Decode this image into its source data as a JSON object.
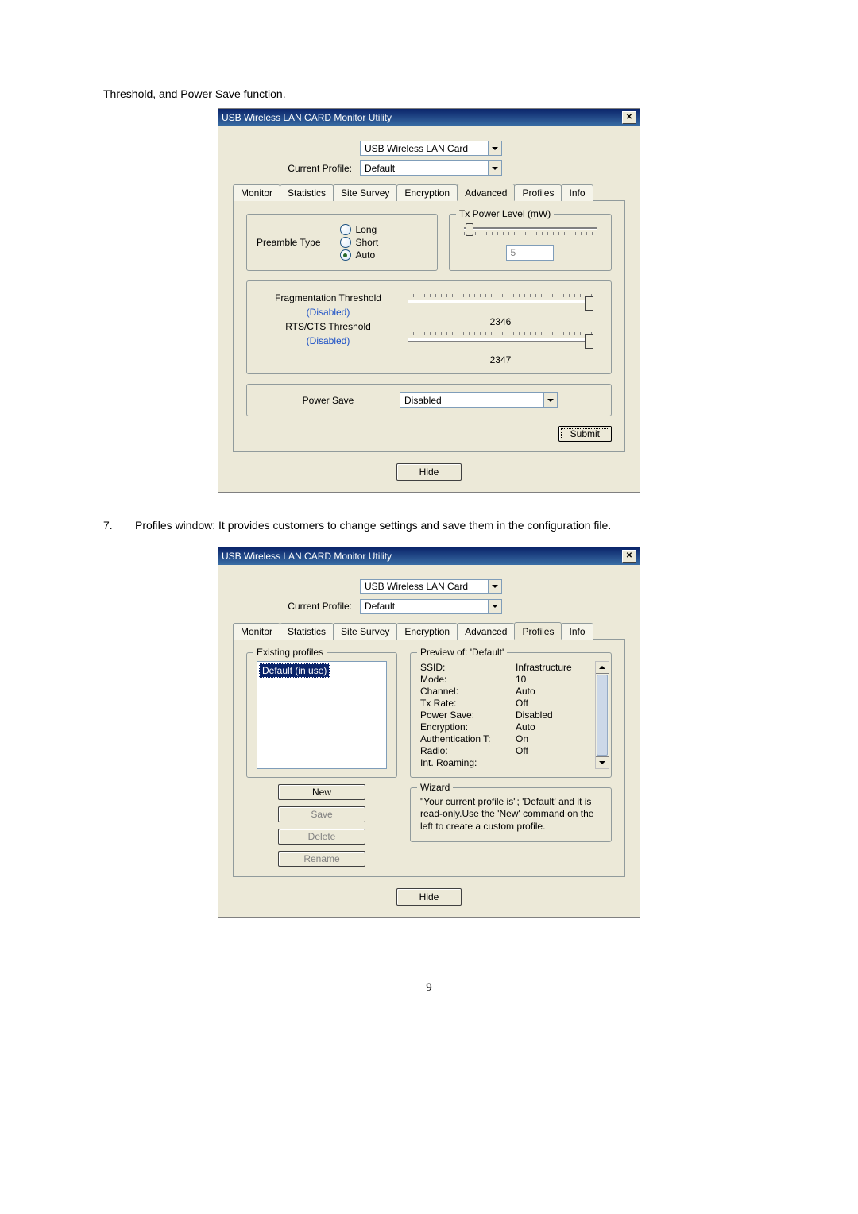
{
  "intro_line": "Threshold, and Power Save function.",
  "dialog1": {
    "title": "USB Wireless LAN CARD Monitor Utility",
    "card_dropdown": "USB Wireless LAN Card",
    "profile_label": "Current Profile:",
    "profile_value": "Default",
    "tabs": [
      "Monitor",
      "Statistics",
      "Site Survey",
      "Encryption",
      "Advanced",
      "Profiles",
      "Info"
    ],
    "active_tab": "Advanced",
    "preamble": {
      "label": "Preamble Type",
      "options": [
        "Long",
        "Short",
        "Auto"
      ],
      "selected": "Auto"
    },
    "tx_power": {
      "legend": "Tx Power Level (mW)",
      "value": "5"
    },
    "frag": {
      "label": "Fragmentation Threshold",
      "state": "(Disabled)",
      "value": "2346"
    },
    "rts": {
      "label": "RTS/CTS Threshold",
      "state": "(Disabled)",
      "value": "2347"
    },
    "power_save": {
      "label": "Power Save",
      "value": "Disabled"
    },
    "submit": "Submit",
    "hide": "Hide"
  },
  "item7": {
    "num": "7.",
    "text": "Profiles window: It provides customers to change settings and save them in the configuration file."
  },
  "dialog2": {
    "title": "USB Wireless LAN CARD Monitor Utility",
    "card_dropdown": "USB Wireless LAN Card",
    "profile_label": "Current Profile:",
    "profile_value": "Default",
    "tabs": [
      "Monitor",
      "Statistics",
      "Site Survey",
      "Encryption",
      "Advanced",
      "Profiles",
      "Info"
    ],
    "active_tab": "Profiles",
    "existing": {
      "legend": "Existing profiles",
      "item": "Default (in use)"
    },
    "buttons": {
      "new": "New",
      "save": "Save",
      "delete": "Delete",
      "rename": "Rename"
    },
    "preview": {
      "legend": "Preview of: 'Default'",
      "rows": [
        {
          "k": "SSID:",
          "v": ""
        },
        {
          "k": "Mode:",
          "v": "Infrastructure"
        },
        {
          "k": "Channel:",
          "v": "10"
        },
        {
          "k": "Tx Rate:",
          "v": "Auto"
        },
        {
          "k": "Power Save:",
          "v": "Off"
        },
        {
          "k": "Encryption:",
          "v": "Disabled"
        },
        {
          "k": "Authentication T:",
          "v": "Auto"
        },
        {
          "k": "Radio:",
          "v": "On"
        },
        {
          "k": "Int. Roaming:",
          "v": "Off"
        }
      ]
    },
    "wizard": {
      "legend": "Wizard",
      "text": "\"Your current profile is\"; 'Default' and it is read-only.Use the 'New' command on the left to create a custom profile."
    },
    "hide": "Hide"
  },
  "page_number": "9"
}
